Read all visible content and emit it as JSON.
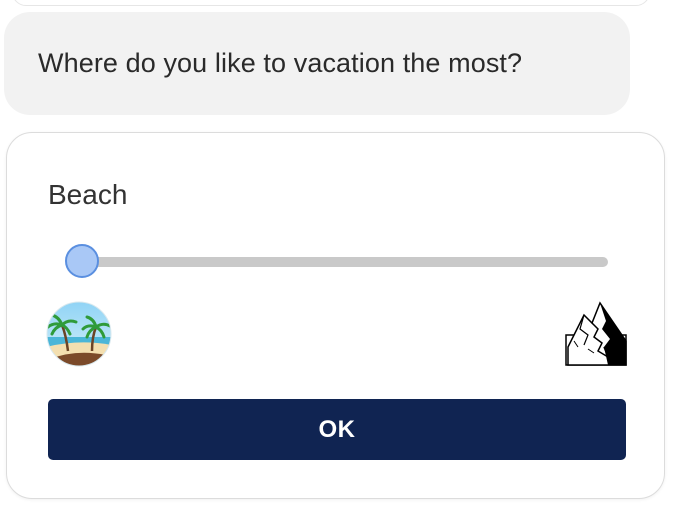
{
  "chat": {
    "question": "Where do you like to vacation the most?"
  },
  "slider": {
    "label": "Beach",
    "value_fraction": 0.0,
    "left_icon": "beach-icon",
    "right_icon": "mountain-icon"
  },
  "actions": {
    "ok_label": "OK"
  },
  "colors": {
    "button": "#102452",
    "thumb_fill": "#a9c8f6",
    "thumb_border": "#5a8fe0",
    "track": "#c9c9c9",
    "bubble": "#f2f2f2"
  }
}
